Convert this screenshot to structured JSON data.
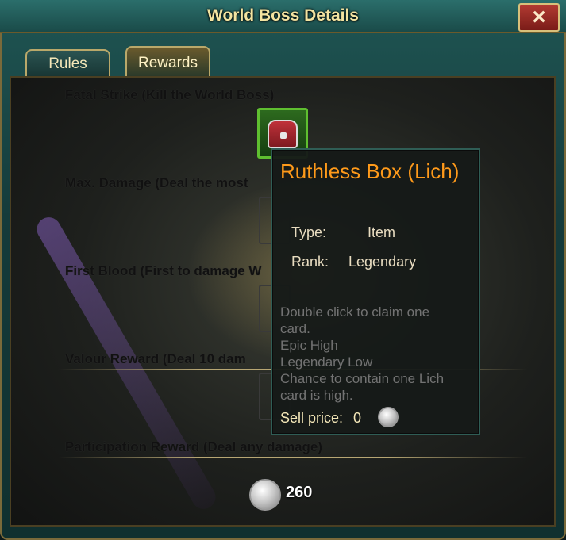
{
  "window": {
    "title": "World Boss Details",
    "close_icon": "×"
  },
  "tabs": [
    {
      "label": "Rules"
    },
    {
      "label": "Rewards",
      "active": true
    }
  ],
  "sections": [
    {
      "label": "Fatal Strike (Kill the World Boss)"
    },
    {
      "label": "Max. Damage (Deal the most"
    },
    {
      "label": "First Blood (First to damage W"
    },
    {
      "label": "Valour Reward (Deal 10 dam"
    },
    {
      "label": "Participation Reward (Deal any damage)"
    }
  ],
  "participation_reward": {
    "amount": "260",
    "icon": "silver-coin-icon"
  },
  "tooltip": {
    "title": "Ruthless Box (Lich)",
    "type_label": "Type:",
    "type_value": "Item",
    "rank_label": "Rank:",
    "rank_value": "Legendary",
    "description": [
      "Double click to claim one",
      "card.",
      "Epic High",
      "Legendary Low",
      "Chance to contain one Lich",
      "card is high."
    ],
    "sell_label": "Sell price:",
    "sell_value": "0",
    "colors": {
      "title": "#ff9a1a",
      "description": "#737373"
    }
  }
}
